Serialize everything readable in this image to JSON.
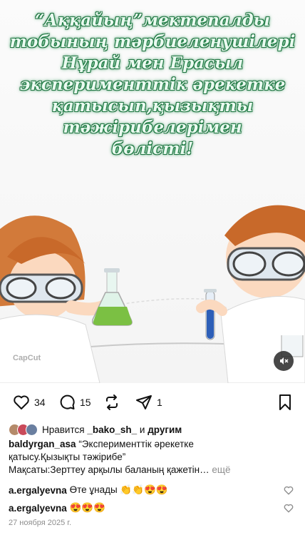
{
  "post": {
    "title_lines": [
      "“Аққайың”мектепалды",
      "тобының тәрбиеленушілері",
      "Нұрай мен Ерасыл",
      "эксперименттік әрекетке",
      "қатысып,қызықты",
      "тәжірибелерімен",
      "бөлісті!"
    ],
    "watermark": "CapCut",
    "mute_icon": "speaker-muted-icon"
  },
  "actions": {
    "likes_count": "34",
    "comments_count": "15",
    "reposts_count": "",
    "shares_count": "1"
  },
  "liked_by": {
    "prefix": "Нравится",
    "user": "_bako_sh_",
    "and": "и",
    "others": "другим"
  },
  "caption": {
    "username": "baldyrgan_asa",
    "line1": "“Эксперименттік әрекетке",
    "line2": "қатысу.Қызықты тәжірибе”",
    "line3": "Мақсаты:Зерттеу арқылы баланың қажетін…",
    "more": "ещё"
  },
  "comments": [
    {
      "user": "a.ergalyevna",
      "text": "Өте ұнады 👏👏😍😍"
    },
    {
      "user": "a.ergalyevna",
      "text": "😍😍😍"
    }
  ],
  "date": "27 ноября 2025 г.",
  "colors": {
    "title_green": "#2f9a5a",
    "text": "#111111",
    "muted": "#8e8e8e"
  }
}
